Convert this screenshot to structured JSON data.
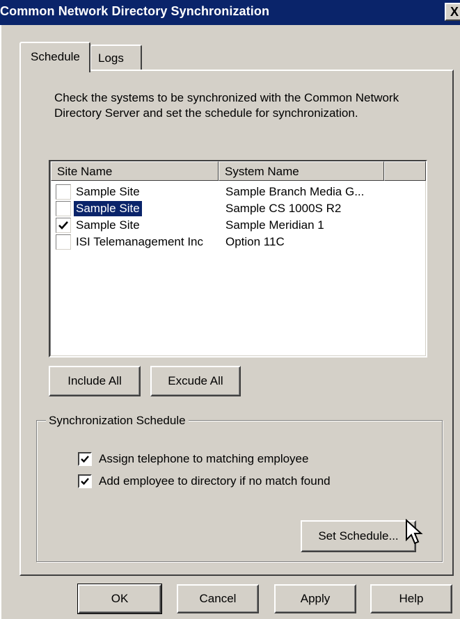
{
  "window": {
    "title": "Common Network Directory Synchronization",
    "close_label": "X"
  },
  "tabs": [
    {
      "label": "Schedule",
      "selected": true
    },
    {
      "label": "Logs",
      "selected": false
    }
  ],
  "instructions": "Check the systems to be synchronized with the Common Network Directory Server and set the schedule for synchronization.",
  "list": {
    "columns": [
      "Site Name",
      "System Name"
    ],
    "rows": [
      {
        "site": "Sample Site",
        "system": "Sample Branch Media G...",
        "checked": false,
        "selected": false
      },
      {
        "site": "Sample Site",
        "system": "Sample CS 1000S R2",
        "checked": false,
        "selected": true
      },
      {
        "site": "Sample Site",
        "system": "Sample Meridian 1",
        "checked": true,
        "selected": false
      },
      {
        "site": "ISI Telemanagement Inc",
        "system": "Option 11C",
        "checked": false,
        "selected": false
      }
    ]
  },
  "buttons": {
    "include_all": "Include All",
    "exclude_all": "Excude All",
    "set_schedule": "Set Schedule...",
    "ok": "OK",
    "cancel": "Cancel",
    "apply": "Apply",
    "help": "Help"
  },
  "schedule_group": {
    "label": "Synchronization Schedule",
    "options": [
      {
        "label": "Assign telephone to matching employee",
        "checked": true
      },
      {
        "label": "Add employee to directory if no match found",
        "checked": true
      }
    ]
  },
  "colors": {
    "title_bar": "#0a246a",
    "face": "#d4d0c8",
    "selection": "#0a246a"
  }
}
